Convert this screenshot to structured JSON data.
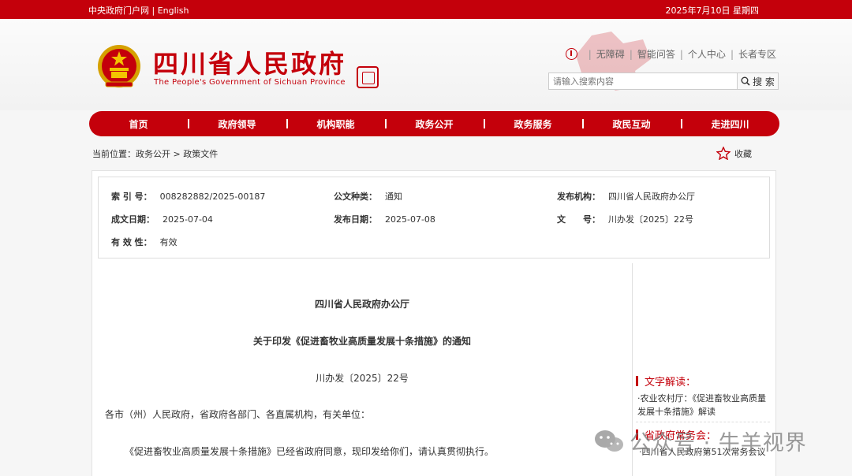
{
  "topbar": {
    "left_link_1": "中央政府门户网",
    "separator": "|",
    "left_link_2": "English",
    "date": "2025年7月10日 星期四"
  },
  "header": {
    "logo_cn": "四川省人民政府",
    "logo_en": "The People's Government of Sichuan Province",
    "links": [
      "无障碍",
      "智能问答",
      "个人中心",
      "长者专区"
    ],
    "search_placeholder": "请输入搜索内容",
    "search_button": "搜 索"
  },
  "nav": [
    "首页",
    "政府领导",
    "机构职能",
    "政务公开",
    "政务服务",
    "政民互动",
    "走进四川"
  ],
  "breadcrumb": "当前位置：政务公开 > 政策文件",
  "favorite_label": "收藏",
  "meta": {
    "index_label": "索 引 号：",
    "index_value": "008282882/2025-00187",
    "type_label": "公文种类：",
    "type_value": "通知",
    "org_label": "发布机构：",
    "org_value": "四川省人民政府办公厅",
    "date_label": "成文日期：",
    "date_value": "2025-07-04",
    "pub_label": "发布日期：",
    "pub_value": "2025-07-08",
    "no_label": "文　　号：",
    "no_value": "川办发〔2025〕22号",
    "valid_label": "有 效 性：",
    "valid_value": "有效"
  },
  "document": {
    "issuer": "四川省人民政府办公厅",
    "title": "关于印发《促进畜牧业高质量发展十条措施》的通知",
    "number": "川办发〔2025〕22号",
    "salutation": "各市（州）人民政府，省政府各部门、各直属机构，有关单位：",
    "body": "《促进畜牧业高质量发展十条措施》已经省政府同意，现印发给你们，请认真贯彻执行。"
  },
  "sidebar": {
    "heading1": "文字解读：",
    "link1": "·农业农村厅：《促进畜牧业高质量发展十条措施》解读",
    "heading2": "省政府常务会：",
    "link2": "·四川省人民政府第51次常务会议"
  },
  "watermark": "公众号 · 牛羊视界",
  "colors": {
    "brand_red": "#c4000b"
  }
}
